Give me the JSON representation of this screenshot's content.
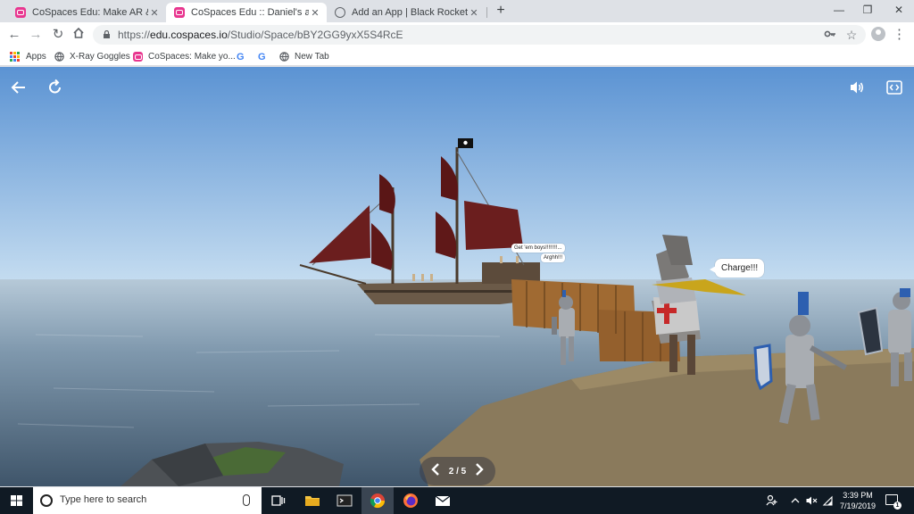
{
  "browser": {
    "tabs": [
      {
        "title": "CoSpaces Edu: Make AR & VR in",
        "favicon": "cospaces-icon",
        "active": false
      },
      {
        "title": "CoSpaces Edu :: Daniel's and Aks",
        "favicon": "cospaces-icon",
        "active": true
      },
      {
        "title": "Add an App | Black Rocket Arcad",
        "favicon": "globe-icon",
        "active": false
      }
    ],
    "url_prefix": "https://",
    "url_host": "edu.cospaces.io",
    "url_path": "/Studio/Space/bBY2GG9yxX5S4RcE",
    "bookmarks": [
      {
        "label": "Apps",
        "icon": "apps-grid-icon"
      },
      {
        "label": "X-Ray Goggles",
        "icon": "globe-icon"
      },
      {
        "label": "CoSpaces: Make yo...",
        "icon": "cospaces-icon"
      },
      {
        "label": "",
        "icon": "google-icon"
      },
      {
        "label": "",
        "icon": "google-icon"
      },
      {
        "label": "New Tab",
        "icon": "globe-icon"
      }
    ],
    "accent": "#e8368f"
  },
  "scene": {
    "speech_pirate_1": "Get 'em boys!!!!!!!!...",
    "speech_pirate_2": "Arghh!!!",
    "speech_knight": "Charge!!!",
    "pager": {
      "current": "2",
      "total": "5",
      "label": "2 / 5"
    },
    "icons": [
      "back-arrow-icon",
      "restart-icon",
      "sound-icon",
      "embed-code-icon"
    ]
  },
  "taskbar": {
    "search_placeholder": "Type here to search",
    "time": "3:39 PM",
    "date": "7/19/2019",
    "notification_count": "1"
  }
}
